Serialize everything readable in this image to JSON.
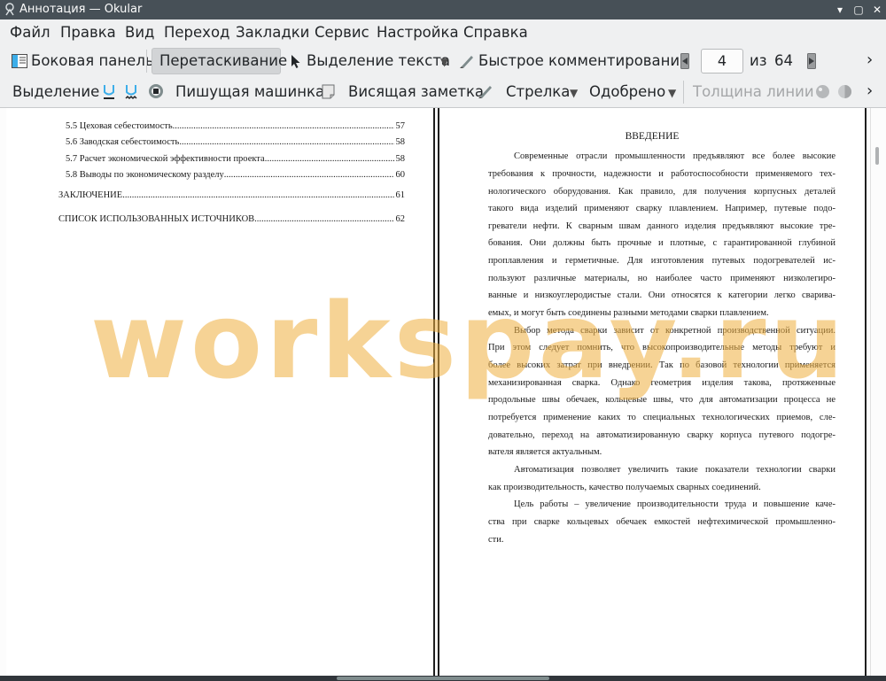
{
  "window": {
    "title": "Аннотация  — Okular",
    "minimize_symbol": "▾",
    "maximize_symbol": "▢",
    "close_symbol": "✕"
  },
  "menubar": {
    "items": [
      "Файл",
      "Правка",
      "Вид",
      "Переход",
      "Закладки",
      "Сервис",
      "Настройка",
      "Справка"
    ]
  },
  "toolbar": {
    "sidebar_label": "Боковая панель",
    "browse_label": "Перетаскивание",
    "text_select_label": "Выделение текста",
    "quick_annotations_label": "Быстрое комментирование",
    "page_current": "4",
    "page_of_label": "из",
    "page_total": "64",
    "more_symbol": "›"
  },
  "annotation_bar": {
    "highlight_label": "Выделение",
    "typewriter_label": "Пишущая машинка",
    "popup_note_label": "Висящая заметка",
    "arrow_label": "Стрелка",
    "stamp_label": "Одобрено",
    "line_width_label": "Толщина линии",
    "more_symbol": "›"
  },
  "icons": {
    "sidebar": "sidebar-icon",
    "browse": "hand-icon",
    "text_select": "cursor-arrow-icon",
    "quick_annotations": "pen-icon",
    "prev_page": "prev-page-icon",
    "next_page": "next-page-icon",
    "underline": "underline-icon",
    "squiggle": "squiggle-icon",
    "stamp": "stamp-icon",
    "note": "note-icon",
    "arrow": "arrow-icon",
    "color": "color-icon",
    "opacity": "opacity-icon"
  },
  "document": {
    "left_page": {
      "toc": [
        {
          "text": "5.5 Цеховая себестоимость",
          "dots": "..................................................................................................................................",
          "page": "57"
        },
        {
          "text": "5.6 Заводская себестоимость",
          "dots": "..................................................................................................................................",
          "page": "58"
        },
        {
          "text": "5.7 Расчет экономической эффективности проекта",
          "dots": "..................................................................................................................................",
          "page": "58"
        },
        {
          "text": "5.8 Выводы по экономическому разделу",
          "dots": "..................................................................................................................................",
          "page": "60"
        },
        {
          "text": "ЗАКЛЮЧЕНИЕ",
          "dots": "..................................................................................................................................",
          "page": "61"
        },
        {
          "text": "СПИСОК ИСПОЛЬЗОВАННЫХ ИСТОЧНИКОВ",
          "dots": "..................................................................................................................................",
          "page": "62"
        }
      ]
    },
    "right_page": {
      "heading": "ВВЕДЕНИЕ",
      "lines": [
        "Современные отрасли промышленности предъявляют все более высокие",
        "требования к прочности, надежности и работоспособности применяемого тех-",
        "нологического оборудования. Как правило, для получения корпусных деталей",
        "такого вида изделий применяют сварку плавлением. Например, путевые подо-",
        "греватели нефти. К сварным швам данного изделия предъявляют высокие тре-",
        "бования. Они должны быть прочные и плотные, с гарантированной глубиной",
        "проплавления и герметичные. Для изготовления путевых подогревателей ис-",
        "пользуют различные материалы, но наиболее часто применяют низколегиро-",
        "ванные и низкоуглеродистые стали. Они относятся к категории легко сварива-",
        "емых, и могут быть соединены разными методами сварки плавлением.",
        "Выбор метода сварки зависит от конкретной производственной ситуации.",
        "При этом следует помнить, что высокопроизводительные методы требуют и",
        "более высоких затрат при внедрении.  Так по базовой технологии применяется",
        "механизированная сварка. Однако геометрия изделия такова, протяженные",
        "продольные швы обечаек, кольцевые швы, что для автоматизации процесса не",
        "потребуется применение каких то специальных технологических приемов, сле-",
        "довательно, переход на автоматизированную сварку корпуса путевого подогре-",
        "вателя является актуальным.",
        "Автоматизация позволяет увеличить такие показатели технологии сварки",
        "как производительность, качество получаемых сварных соединений.",
        "Цель работы – увеличение производительности труда и повышение каче-",
        "ства при сварке кольцевых обечаек емкостей нефтехимической промышленно-",
        "сти."
      ]
    }
  },
  "watermark": "workspay.ru",
  "colors": {
    "titlebar": "#475057",
    "toolbar": "#eff0f1",
    "watermark": "#f0b040"
  }
}
